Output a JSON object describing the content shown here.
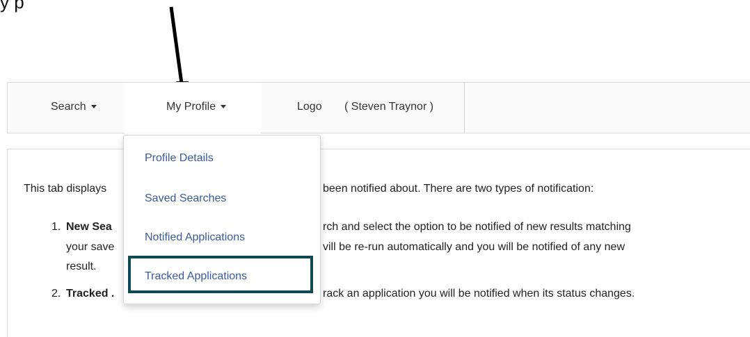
{
  "caption": {
    "text": "y                      p"
  },
  "annotation": {
    "arrow_color": "#000000",
    "highlight_color": "#0f4a52"
  },
  "navbar": {
    "search_label": "Search",
    "profile_label": "My Profile",
    "logo_label": "Logo",
    "user_label": "( Steven Traynor )"
  },
  "dropdown": {
    "items": [
      {
        "label": "Profile Details"
      },
      {
        "label": "Saved Searches"
      },
      {
        "label": "Notified Applications"
      },
      {
        "label": "Tracked Applications"
      }
    ]
  },
  "content": {
    "intro_left": "This tab displays",
    "intro_right": "been notified about. There are two types of notification:",
    "item1_num": "1.",
    "item1_bold": "New Sea",
    "item1_right": "rch and select the option to be notified of new results matching",
    "item1_line2_left": "your save",
    "item1_line2_right": "vill be re-run automatically and you will be notified of any new",
    "item1_line3": "result.",
    "item2_num": "2.",
    "item2_bold": "Tracked .",
    "item2_right": "rack an application you will be notified when its status changes."
  }
}
